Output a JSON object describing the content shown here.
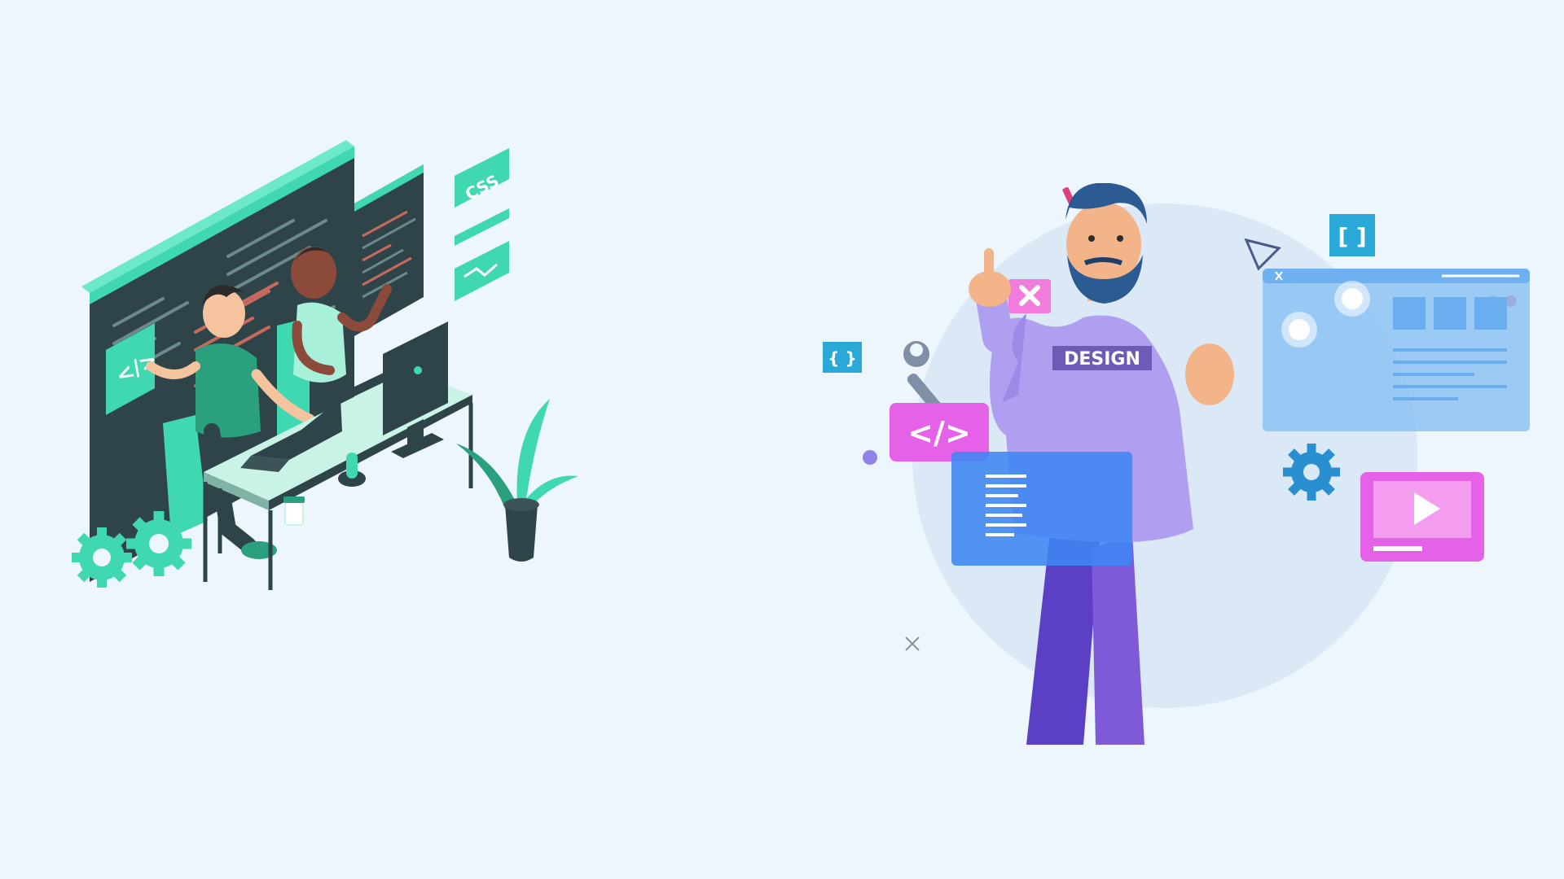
{
  "left_illustration": {
    "css_badge_text": "CSS",
    "code_tag_text": "</>"
  },
  "right_illustration": {
    "shirt_text": "DESIGN",
    "code_card_text": "</>",
    "bracket_badge_text": "[ ]",
    "bracket_small_text": "{ }"
  },
  "colors": {
    "background": "#eef6fd",
    "left_accent": "#3fd8b0",
    "left_dark": "#2f4448",
    "right_purple": "#a88ee8",
    "right_pink": "#e562e8",
    "right_blue": "#3d86f2",
    "right_cyan": "#2aa9d8"
  },
  "icons": [
    "gear-icon",
    "wrench-icon",
    "play-icon",
    "close-icon",
    "code-icon",
    "triangle-icon",
    "cactus-icon",
    "coffee-cup-icon",
    "plant-icon"
  ]
}
